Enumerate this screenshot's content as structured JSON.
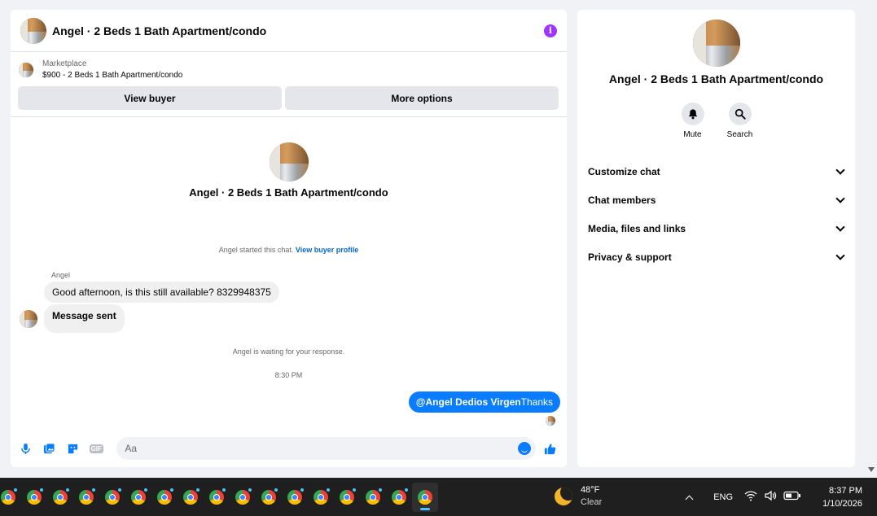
{
  "chat": {
    "title": "Angel · 2 Beds 1 Bath Apartment/condo",
    "marketplace_label": "Marketplace",
    "listing": "$900 - 2 Beds 1 Bath Apartment/condo",
    "view_buyer": "View buyer",
    "more_options": "More options",
    "intro_title": "Angel · 2 Beds 1 Bath Apartment/condo",
    "started_text": "Angel started this chat.",
    "view_buyer_profile": "View buyer profile",
    "sender_name": "Angel",
    "message_1": "Good afternoon, is this still available? 8329948375",
    "message_2": "Message sent",
    "waiting_text": "Angel is waiting for your response.",
    "timestamp": "8:30 PM",
    "outgoing_mention": "@Angel Dedios Virgen",
    "outgoing_text": "Thanks",
    "composer_placeholder": "Aa",
    "gif_label": "GIF"
  },
  "side": {
    "title": "Angel · 2 Beds 1 Bath Apartment/condo",
    "mute_label": "Mute",
    "search_label": "Search",
    "menu": [
      {
        "label": "Customize chat"
      },
      {
        "label": "Chat members"
      },
      {
        "label": "Media, files and links"
      },
      {
        "label": "Privacy & support"
      }
    ]
  },
  "taskbar": {
    "apps": [
      "chrome",
      "chrome",
      "chrome",
      "chrome",
      "chrome",
      "chrome",
      "chrome",
      "chrome",
      "chrome",
      "chrome",
      "chrome",
      "chrome",
      "chrome",
      "chrome",
      "chrome",
      "chrome",
      "chrome"
    ],
    "temperature": "48°F",
    "condition": "Clear",
    "language": "ENG",
    "time": "8:37 PM",
    "date": "1/10/2026"
  },
  "colors": {
    "accent": "#0a7cff",
    "info": "#a033ff"
  }
}
